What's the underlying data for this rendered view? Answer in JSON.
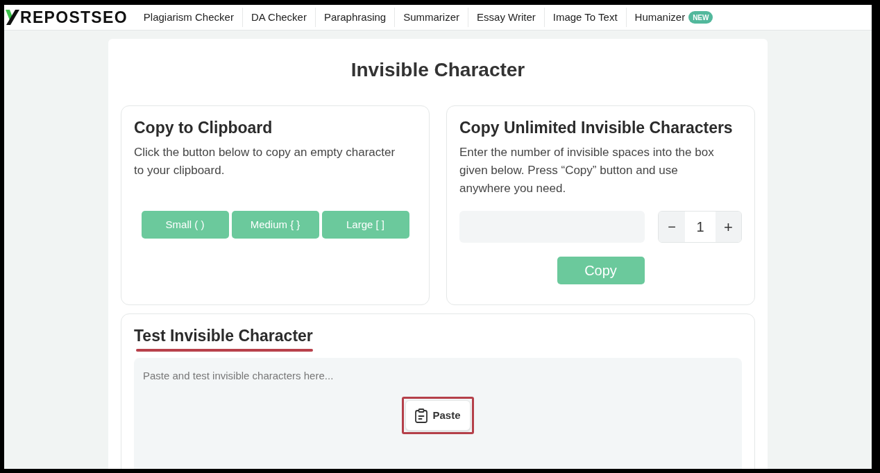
{
  "header": {
    "logo": "REPOSTSEO",
    "nav": [
      {
        "label": "Plagiarism Checker"
      },
      {
        "label": "DA Checker"
      },
      {
        "label": "Paraphrasing"
      },
      {
        "label": "Summarizer"
      },
      {
        "label": "Essay Writer"
      },
      {
        "label": "Image To Text"
      },
      {
        "label": "Humanizer",
        "badge": "NEW"
      }
    ]
  },
  "page": {
    "title": "Invisible Character"
  },
  "copy_card": {
    "title": "Copy to Clipboard",
    "description": "Click the button below to copy an empty character to your clipboard.",
    "buttons": [
      "Small ( )",
      "Medium { }",
      "Large [ ]"
    ]
  },
  "unlimited_card": {
    "title": "Copy Unlimited Invisible Characters",
    "description": "Enter the number of invisible spaces into the box given below. Press “Copy” button and use anywhere you need.",
    "stepper": {
      "decrement": "−",
      "value": "1",
      "increment": "+"
    },
    "button": "Copy"
  },
  "test_section": {
    "title": "Test Invisible Character",
    "underlined": true,
    "textarea": {
      "placeholder": "Paste and test invisible characters here..."
    },
    "paste_button": {
      "label": "Paste",
      "highlighted": true
    }
  }
}
